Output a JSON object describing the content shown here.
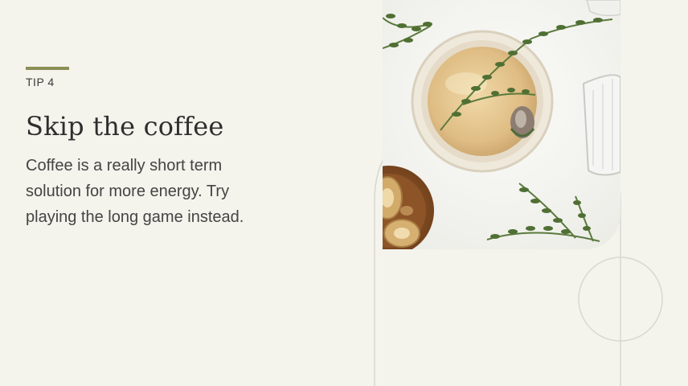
{
  "tip": {
    "label": "TIP 4"
  },
  "heading": {
    "title": "Skip the coffee"
  },
  "content": {
    "body": "Coffee is a really short term solution for more energy. Try playing the long game instead."
  },
  "image": {
    "subject": "herbal tea with thyme sprigs",
    "icon": "tea-photo"
  },
  "colors": {
    "background": "#f4f3ec",
    "accent": "#8a8f55",
    "heading": "#2e2e2e",
    "body": "#444444",
    "outline": "#d8d7d0"
  }
}
